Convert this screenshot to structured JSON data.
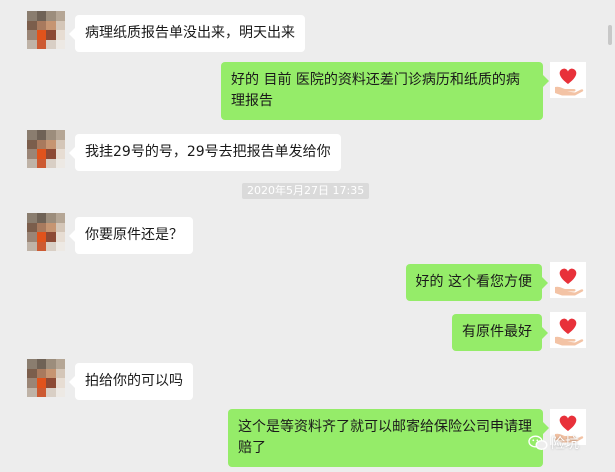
{
  "chat": {
    "messages": [
      {
        "side": "in",
        "text": "病理纸质报告单没出来，明天出来"
      },
      {
        "side": "out",
        "text": "好的   目前  医院的资料还差门诊病历和纸质的病理报告"
      },
      {
        "side": "in",
        "text": "我挂29号的号，29号去把报告单发给你"
      },
      {
        "side": "in",
        "text": "你要原件还是？"
      },
      {
        "side": "out",
        "text": "好的  这个看您方便"
      },
      {
        "side": "out",
        "text": "有原件最好"
      },
      {
        "side": "in",
        "text": "拍给你的可以吗"
      },
      {
        "side": "out",
        "text": "这个是等资料齐了就可以邮寄给保险公司申请理赔了"
      }
    ],
    "timestamp": "2020年5月27日 17:35"
  },
  "watermark": {
    "text": "险坑",
    "icon": "wechat-icon"
  },
  "colors": {
    "background": "#ededed",
    "incoming_bubble": "#ffffff",
    "outgoing_bubble": "#95ec69",
    "timestamp_bg": "#dadada",
    "heart": "#e8313a"
  },
  "avatars": {
    "contact": "pixelated-avatar-icon",
    "self": "heart-in-hand-icon"
  }
}
